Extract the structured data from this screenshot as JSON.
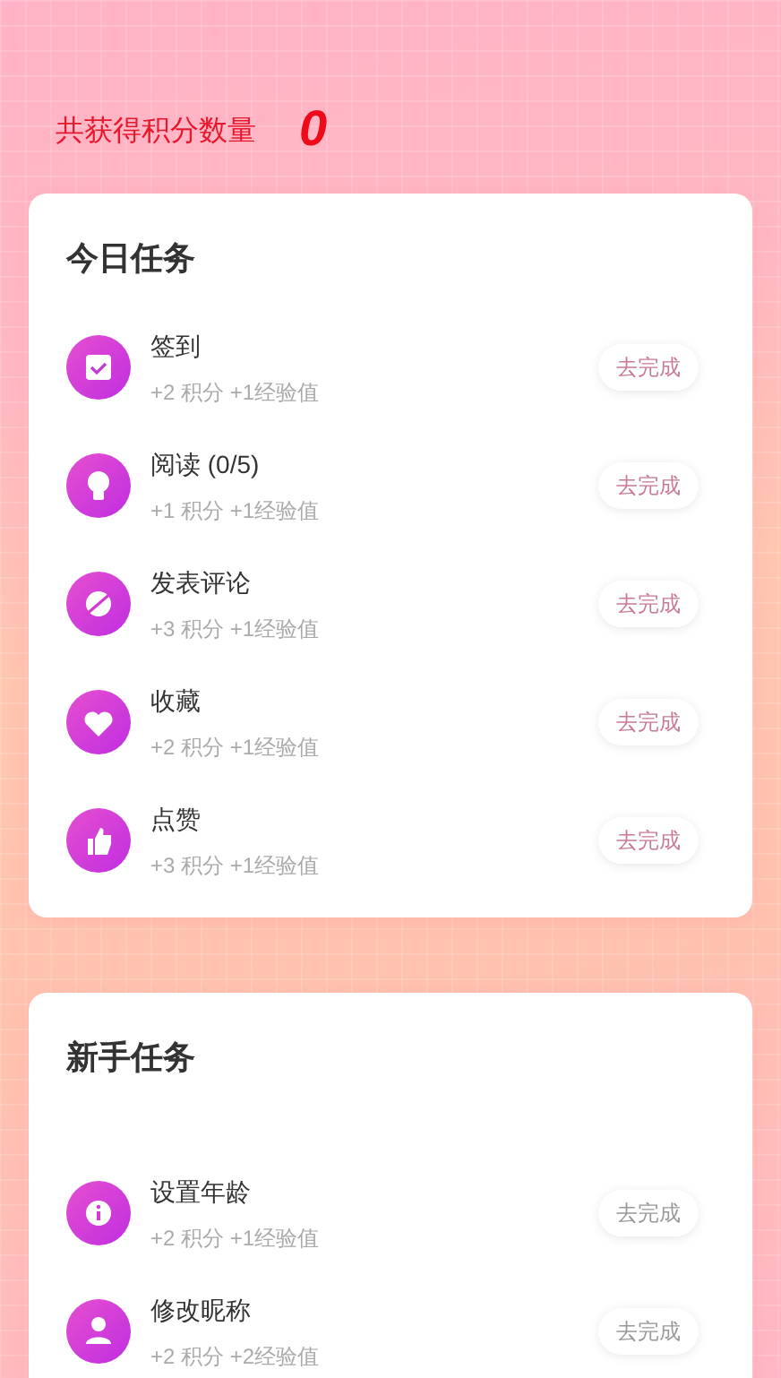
{
  "header": {
    "label": "共获得积分数量",
    "points": "0"
  },
  "sections": [
    {
      "title": "今日任务",
      "tasks": [
        {
          "kind": "check",
          "name": "签到",
          "reward": "+2 积分 +1经验值",
          "button": "去完成",
          "disabled": false
        },
        {
          "kind": "bulb",
          "name": "阅读 (0/5)",
          "reward": "+1 积分 +1经验值",
          "button": "去完成",
          "disabled": false
        },
        {
          "kind": "comment",
          "name": "发表评论",
          "reward": "+3 积分 +1经验值",
          "button": "去完成",
          "disabled": false
        },
        {
          "kind": "heart",
          "name": "收藏",
          "reward": "+2 积分 +1经验值",
          "button": "去完成",
          "disabled": false
        },
        {
          "kind": "thumb",
          "name": "点赞",
          "reward": "+3 积分 +1经验值",
          "button": "去完成",
          "disabled": false
        }
      ]
    },
    {
      "title": "新手任务",
      "tasks": [
        {
          "kind": "info",
          "name": "设置年龄",
          "reward": "+2 积分 +1经验值",
          "button": "去完成",
          "disabled": true
        },
        {
          "kind": "user",
          "name": "修改昵称",
          "reward": "+2 积分 +2经验值",
          "button": "去完成",
          "disabled": true
        }
      ]
    }
  ]
}
